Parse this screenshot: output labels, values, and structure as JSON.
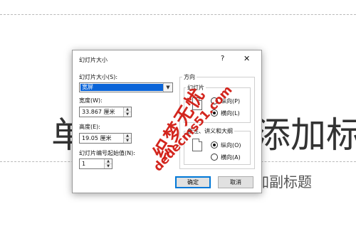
{
  "slide": {
    "title_left": "单",
    "title_right": "添加标",
    "subtitle_right": "加副标题"
  },
  "dialog": {
    "title": "幻灯片大小",
    "help_glyph": "?",
    "close_glyph": "✕",
    "slide_size_label": "幻灯片大小(S):",
    "slide_size_value": "宽屏",
    "width_label": "宽度(W):",
    "width_value": "33.867 厘米",
    "height_label": "高度(E):",
    "height_value": "19.05 厘米",
    "numbering_label": "幻灯片编号起始值(N):",
    "numbering_value": "1",
    "orientation": {
      "group_label": "方向",
      "slides_label": "幻灯片",
      "slides_portrait": "纵向(P)",
      "slides_landscape": "横向(L)",
      "slides_selected": "landscape",
      "notes_label": "备注、讲义和大纲",
      "notes_portrait": "纵向(O)",
      "notes_landscape": "横向(A)",
      "notes_selected": "portrait"
    },
    "ok_label": "确定",
    "cancel_label": "取消"
  },
  "watermark": {
    "line1": "织梦无忧",
    "line2": "dedecms51.com"
  }
}
